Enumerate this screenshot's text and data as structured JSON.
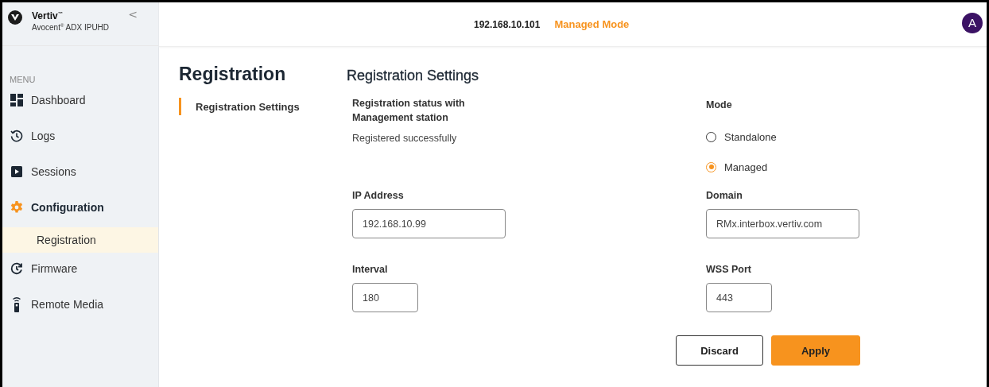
{
  "sidebar": {
    "brand": {
      "name": "Vertiv$^{™}$",
      "product": "Avocent$^{®}$ ADX IPUHD"
    },
    "collapse": "<",
    "menu_label": "MENU",
    "items": [
      {
        "label": "Dashboard",
        "kind": "dashboard",
        "selected": false
      },
      {
        "label": "Logs",
        "kind": "history",
        "selected": false
      },
      {
        "label": "Sessions",
        "kind": "session",
        "selected": false
      },
      {
        "label": "Configuration",
        "kind": "gear",
        "selected": true,
        "children": [
          {
            "label": "Registration",
            "selected": true
          }
        ]
      },
      {
        "label": "Firmware",
        "kind": "refresh",
        "selected": false
      },
      {
        "label": "Remote Media",
        "kind": "remote",
        "selected": false
      }
    ]
  },
  "header": {
    "ip": "192.168.10.101",
    "mode": "Managed Mode",
    "avatar": "A"
  },
  "page": {
    "title": "Registration",
    "nav": [
      {
        "label": "Registration Settings",
        "selected": true
      }
    ]
  },
  "settings": {
    "title": "Registration Settings",
    "status_label": "Registration status with Management station",
    "status_value": "Registered successfully",
    "mode": {
      "label": "Mode",
      "options": [
        {
          "label": "Standalone",
          "selected": false
        },
        {
          "label": "Managed",
          "selected": true
        }
      ]
    },
    "fields": [
      {
        "label": "IP Address",
        "value": "192.168.10.99",
        "kind": "long"
      },
      {
        "label": "Domain",
        "value": "RMx.interbox.vertiv.com",
        "kind": "long"
      },
      {
        "label": "Interval",
        "value": "180",
        "kind": "short"
      },
      {
        "label": "WSS Port",
        "value": "443",
        "kind": "short"
      }
    ],
    "buttons": [
      {
        "label": "Discard",
        "kind": "secondary"
      },
      {
        "label": "Apply",
        "kind": "primary"
      }
    ]
  }
}
